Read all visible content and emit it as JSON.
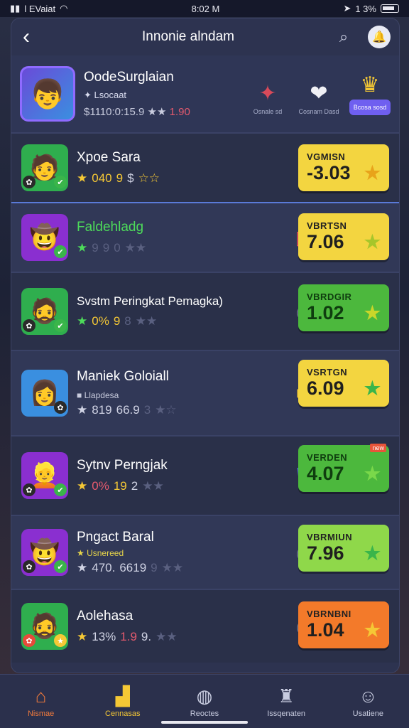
{
  "status_bar": {
    "left": "l EVaiat",
    "time": "8:02 M",
    "right": "1 3%"
  },
  "header": {
    "title": "Innonie alndam"
  },
  "profile": {
    "name": "OodeSurglaian",
    "subtitle": "Lsocaat",
    "stats": "$1110:0:15.9",
    "stat_red": "1.90",
    "tabs": [
      {
        "label": "Osnale sd",
        "icon": "rank-icon"
      },
      {
        "label": "Cosnam Dasd",
        "icon": "heart-icon"
      },
      {
        "label": "Bcosa sosd",
        "icon": "crown-icon"
      }
    ]
  },
  "rows": [
    {
      "name": "Xpoe Sara",
      "subtitle": "",
      "stats": [
        "040",
        "9",
        "$"
      ],
      "badge_label": "VGMISN",
      "badge_value": "-3.03",
      "badge_color": "yellow",
      "avatar_bg": "#2fae4e",
      "avatar_glyph": "🧑"
    },
    {
      "name": "Faldehladg",
      "subtitle": "",
      "stats": [
        "9",
        "9",
        "0"
      ],
      "badge_label": "VBRTSN",
      "badge_value": "7.06",
      "badge_color": "yellow",
      "avatar_bg": "#8a2fd0",
      "avatar_glyph": "🤠"
    },
    {
      "name": "Svstm Peringkat Pemagka)",
      "subtitle": "",
      "stats": [
        "0%",
        "9",
        "8"
      ],
      "badge_label": "VBRDGIR",
      "badge_value": "1.02",
      "badge_color": "green",
      "avatar_bg": "#2fae4e",
      "avatar_glyph": "🧔"
    },
    {
      "name": "Maniek Goloiall",
      "subtitle": "Llapdesa",
      "stats": [
        "819",
        "66.9",
        "3"
      ],
      "badge_label": "VSRTGN",
      "badge_value": "6.09",
      "badge_color": "yellow",
      "avatar_bg": "#3a8fe0",
      "avatar_glyph": "👩"
    },
    {
      "name": "Sytnv Perngjak",
      "subtitle": "",
      "stats": [
        "0%",
        "19",
        "2"
      ],
      "badge_label": "VERDEN",
      "badge_value": "4.07",
      "badge_color": "green",
      "avatar_bg": "#8a2fd0",
      "avatar_glyph": "👱"
    },
    {
      "name": "Pngact Baral",
      "subtitle": "Usnereed",
      "stats": [
        "470.",
        "6619",
        "9"
      ],
      "badge_label": "VBRMIUN",
      "badge_value": "7.96",
      "badge_color": "lgreen",
      "avatar_bg": "#8a2fd0",
      "avatar_glyph": "🤠"
    },
    {
      "name": "Aolehasa",
      "subtitle": "",
      "stats": [
        "13%",
        "1.9",
        "9."
      ],
      "badge_label": "VBRNBNI",
      "badge_value": "1.04",
      "badge_color": "orange",
      "avatar_bg": "#2fae4e",
      "avatar_glyph": "🧔"
    }
  ],
  "badge_tag": "new",
  "nav": [
    {
      "label": "Nismae",
      "icon": "home-icon"
    },
    {
      "label": "Cennasas",
      "icon": "chart-icon"
    },
    {
      "label": "Reoctes",
      "icon": "chat-icon"
    },
    {
      "label": "Issqenaten",
      "icon": "trophy-icon"
    },
    {
      "label": "Usatiene",
      "icon": "user-icon"
    }
  ]
}
